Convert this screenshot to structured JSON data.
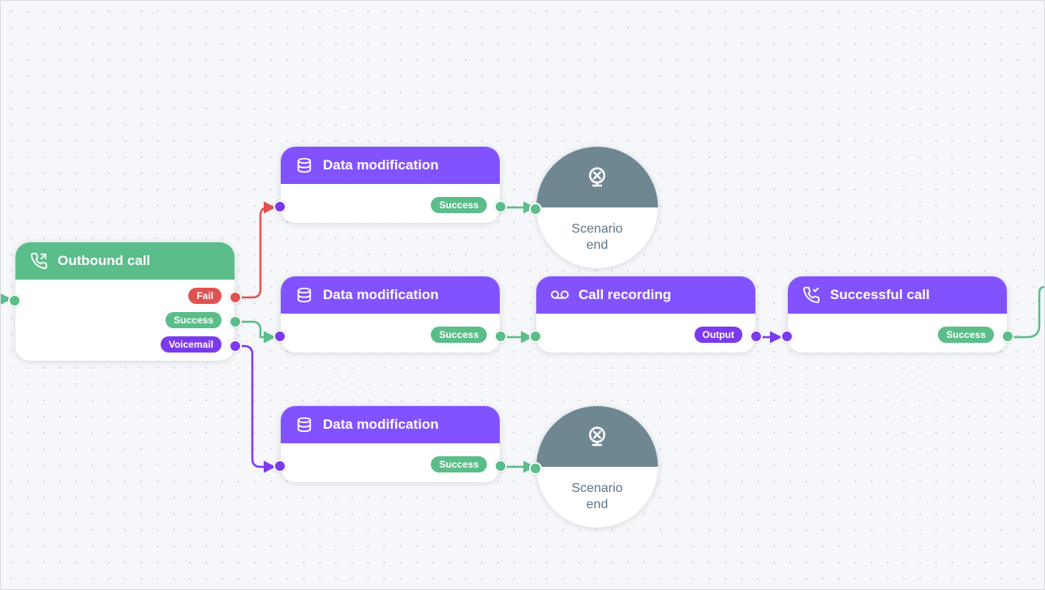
{
  "nodes": {
    "outbound": {
      "title": "Outbound call",
      "outputs": {
        "fail": "Fail",
        "success": "Success",
        "voicemail": "Voicemail"
      }
    },
    "data_mod_top": {
      "title": "Data modification",
      "outputs": {
        "success": "Success"
      }
    },
    "data_mod_mid": {
      "title": "Data modification",
      "outputs": {
        "success": "Success"
      }
    },
    "data_mod_bot": {
      "title": "Data modification",
      "outputs": {
        "success": "Success"
      }
    },
    "call_recording": {
      "title": "Call recording",
      "outputs": {
        "output": "Output"
      }
    },
    "successful_call": {
      "title": "Successful call",
      "outputs": {
        "success": "Success"
      }
    },
    "end_top": {
      "title": "Scenario\nend"
    },
    "end_bot": {
      "title": "Scenario\nend"
    }
  },
  "edges": [
    {
      "from": "outbound.fail",
      "to": "data_mod_top.in",
      "color": "red"
    },
    {
      "from": "outbound.success",
      "to": "data_mod_mid.in",
      "color": "green"
    },
    {
      "from": "outbound.voicemail",
      "to": "data_mod_bot.in",
      "color": "purple"
    },
    {
      "from": "data_mod_top.success",
      "to": "end_top.in",
      "color": "green"
    },
    {
      "from": "data_mod_mid.success",
      "to": "call_recording.in",
      "color": "green"
    },
    {
      "from": "data_mod_bot.success",
      "to": "end_bot.in",
      "color": "green"
    },
    {
      "from": "call_recording.output",
      "to": "successful_call.in",
      "color": "purple"
    },
    {
      "from": "successful_call.success",
      "to": "offscreen.right",
      "color": "green"
    },
    {
      "from": "offscreen.left",
      "to": "outbound.in",
      "color": "green"
    }
  ],
  "colors": {
    "green": "#5bbd8a",
    "purple": "#7c3aed",
    "red": "#e05252"
  }
}
